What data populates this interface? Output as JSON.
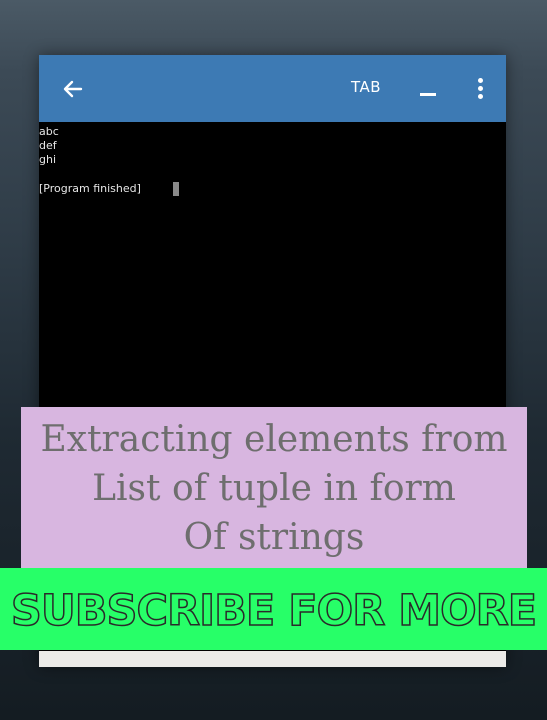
{
  "appbar": {
    "tab_label": "TAB",
    "back_icon": "arrow-left-icon",
    "minimize_icon": "minimize-icon",
    "more_icon": "more-vertical-icon",
    "color": "#3d7ab4"
  },
  "terminal": {
    "lines": [
      "abc",
      "def",
      "ghi",
      "",
      "[Program finished]"
    ]
  },
  "overlay": {
    "title_lines": [
      "Extracting elements from",
      "List of tuple in form",
      "Of strings"
    ],
    "background": "#d8b6e0"
  },
  "banner": {
    "text": "SUBSCRIBE FOR MORE",
    "background": "#27ff68"
  }
}
